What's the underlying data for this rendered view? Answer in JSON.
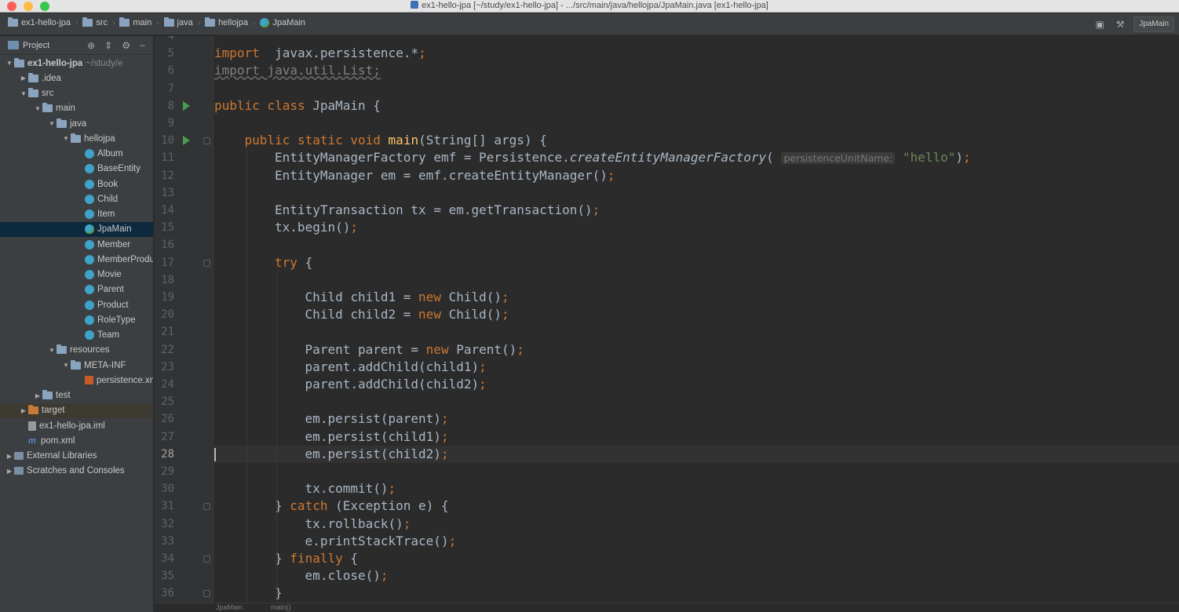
{
  "window": {
    "title": "ex1-hello-jpa [~/study/ex1-hello-jpa] - .../src/main/java/hellojpa/JpaMain.java [ex1-hello-jpa]"
  },
  "navbar": {
    "crumbs": [
      "ex1-hello-jpa",
      "src",
      "main",
      "java",
      "hellojpa",
      "JpaMain"
    ],
    "run_config": "JpaMain"
  },
  "project": {
    "title": "Project",
    "tree": [
      {
        "label": "ex1-hello-jpa",
        "suffix": "~/study/e",
        "icon": "module-folder-icon",
        "arrow": "▼",
        "indent": 0,
        "bold": true
      },
      {
        "label": ".idea",
        "icon": "folder-icon",
        "arrow": "▶",
        "indent": 1
      },
      {
        "label": "src",
        "icon": "folder-icon",
        "arrow": "▼",
        "indent": 1
      },
      {
        "label": "main",
        "icon": "folder-icon",
        "arrow": "▼",
        "indent": 2
      },
      {
        "label": "java",
        "icon": "source-folder-icon",
        "arrow": "▼",
        "indent": 3
      },
      {
        "label": "hellojpa",
        "icon": "package-icon",
        "arrow": "▼",
        "indent": 4
      },
      {
        "label": "Album",
        "icon": "class-icon",
        "arrow": "",
        "indent": 5
      },
      {
        "label": "BaseEntity",
        "icon": "class-icon",
        "arrow": "",
        "indent": 5
      },
      {
        "label": "Book",
        "icon": "class-icon",
        "arrow": "",
        "indent": 5
      },
      {
        "label": "Child",
        "icon": "class-icon",
        "arrow": "",
        "indent": 5
      },
      {
        "label": "Item",
        "icon": "class-icon",
        "arrow": "",
        "indent": 5
      },
      {
        "label": "JpaMain",
        "icon": "main-class-icon",
        "arrow": "",
        "indent": 5,
        "selected": true
      },
      {
        "label": "Member",
        "icon": "class-icon",
        "arrow": "",
        "indent": 5
      },
      {
        "label": "MemberProduct",
        "icon": "class-icon",
        "arrow": "",
        "indent": 5
      },
      {
        "label": "Movie",
        "icon": "class-icon",
        "arrow": "",
        "indent": 5
      },
      {
        "label": "Parent",
        "icon": "class-icon",
        "arrow": "",
        "indent": 5
      },
      {
        "label": "Product",
        "icon": "class-icon",
        "arrow": "",
        "indent": 5
      },
      {
        "label": "RoleType",
        "icon": "class-icon",
        "arrow": "",
        "indent": 5
      },
      {
        "label": "Team",
        "icon": "class-icon",
        "arrow": "",
        "indent": 5
      },
      {
        "label": "resources",
        "icon": "resources-folder-icon",
        "arrow": "▼",
        "indent": 3
      },
      {
        "label": "META-INF",
        "icon": "folder-icon",
        "arrow": "▼",
        "indent": 4
      },
      {
        "label": "persistence.xml",
        "icon": "xml-file-icon",
        "arrow": "",
        "indent": 5
      },
      {
        "label": "test",
        "icon": "folder-icon",
        "arrow": "▶",
        "indent": 2
      },
      {
        "label": "target",
        "icon": "excluded-folder-icon",
        "arrow": "▶",
        "indent": 1,
        "highlight": true
      },
      {
        "label": "ex1-hello-jpa.iml",
        "icon": "iml-file-icon",
        "arrow": "",
        "indent": 1
      },
      {
        "label": "pom.xml",
        "icon": "maven-icon",
        "arrow": "",
        "indent": 1
      },
      {
        "label": "External Libraries",
        "icon": "library-icon",
        "arrow": "▶",
        "indent": 0
      },
      {
        "label": "Scratches and Consoles",
        "icon": "scratch-icon",
        "arrow": "▶",
        "indent": 0
      }
    ]
  },
  "editor": {
    "current_line": 28,
    "lines": [
      {
        "n": 4,
        "indent": 0,
        "tokens": []
      },
      {
        "n": 5,
        "indent": 0,
        "tokens": [
          [
            "kw",
            "import"
          ],
          [
            "",
            "  javax.persistence.*"
          ],
          [
            "kw",
            ";"
          ]
        ]
      },
      {
        "n": 6,
        "indent": 0,
        "tokens": [
          [
            "unused",
            "import java.util.List;"
          ]
        ]
      },
      {
        "n": 7,
        "indent": 0,
        "tokens": []
      },
      {
        "n": 8,
        "indent": 0,
        "run": true,
        "tokens": [
          [
            "kw",
            "public class "
          ],
          [
            "",
            "JpaMain {"
          ]
        ]
      },
      {
        "n": 9,
        "indent": 0,
        "tokens": []
      },
      {
        "n": 10,
        "indent": 1,
        "run": true,
        "fold": true,
        "tokens": [
          [
            "kw",
            "public static void "
          ],
          [
            "fn",
            "main"
          ],
          [
            "",
            "(String[] args) {"
          ]
        ]
      },
      {
        "n": 11,
        "indent": 2,
        "tokens": [
          [
            "",
            "EntityManagerFactory emf = Persistence."
          ],
          [
            "it",
            "createEntityManagerFactory"
          ],
          [
            "",
            "( "
          ],
          [
            "hint",
            "persistenceUnitName:"
          ],
          [
            "",
            " "
          ],
          [
            "str",
            "\"hello\""
          ],
          [
            "",
            ")"
          ],
          [
            "kw",
            ";"
          ]
        ]
      },
      {
        "n": 12,
        "indent": 2,
        "tokens": [
          [
            "",
            "EntityManager em = emf.createEntityManager()"
          ],
          [
            "kw",
            ";"
          ]
        ]
      },
      {
        "n": 13,
        "indent": 0,
        "tokens": []
      },
      {
        "n": 14,
        "indent": 2,
        "tokens": [
          [
            "",
            "EntityTransaction tx = em.getTransaction()"
          ],
          [
            "kw",
            ";"
          ]
        ]
      },
      {
        "n": 15,
        "indent": 2,
        "tokens": [
          [
            "",
            "tx.begin()"
          ],
          [
            "kw",
            ";"
          ]
        ]
      },
      {
        "n": 16,
        "indent": 0,
        "tokens": []
      },
      {
        "n": 17,
        "indent": 2,
        "fold": true,
        "tokens": [
          [
            "kw",
            "try "
          ],
          [
            "",
            "{"
          ]
        ]
      },
      {
        "n": 18,
        "indent": 0,
        "tokens": []
      },
      {
        "n": 19,
        "indent": 3,
        "tokens": [
          [
            "",
            "Child child1 = "
          ],
          [
            "kw",
            "new "
          ],
          [
            "",
            "Child()"
          ],
          [
            "kw",
            ";"
          ]
        ]
      },
      {
        "n": 20,
        "indent": 3,
        "tokens": [
          [
            "",
            "Child child2 = "
          ],
          [
            "kw",
            "new "
          ],
          [
            "",
            "Child()"
          ],
          [
            "kw",
            ";"
          ]
        ]
      },
      {
        "n": 21,
        "indent": 0,
        "tokens": []
      },
      {
        "n": 22,
        "indent": 3,
        "tokens": [
          [
            "",
            "Parent parent = "
          ],
          [
            "kw",
            "new "
          ],
          [
            "",
            "Parent()"
          ],
          [
            "kw",
            ";"
          ]
        ]
      },
      {
        "n": 23,
        "indent": 3,
        "tokens": [
          [
            "",
            "parent.addChild(child1)"
          ],
          [
            "kw",
            ";"
          ]
        ]
      },
      {
        "n": 24,
        "indent": 3,
        "tokens": [
          [
            "",
            "parent.addChild(child2)"
          ],
          [
            "kw",
            ";"
          ]
        ]
      },
      {
        "n": 25,
        "indent": 0,
        "tokens": []
      },
      {
        "n": 26,
        "indent": 3,
        "tokens": [
          [
            "",
            "em.persist(parent)"
          ],
          [
            "kw",
            ";"
          ]
        ]
      },
      {
        "n": 27,
        "indent": 3,
        "tokens": [
          [
            "",
            "em.persist(child1)"
          ],
          [
            "kw",
            ";"
          ]
        ]
      },
      {
        "n": 28,
        "indent": 3,
        "tokens": [
          [
            "",
            "em.persist(child2)"
          ],
          [
            "kw",
            ";"
          ]
        ]
      },
      {
        "n": 29,
        "indent": 0,
        "tokens": []
      },
      {
        "n": 30,
        "indent": 3,
        "tokens": [
          [
            "",
            "tx.commit()"
          ],
          [
            "kw",
            ";"
          ]
        ]
      },
      {
        "n": 31,
        "indent": 2,
        "fold": true,
        "tokens": [
          [
            "",
            "} "
          ],
          [
            "kw",
            "catch "
          ],
          [
            "",
            "(Exception e) {"
          ]
        ]
      },
      {
        "n": 32,
        "indent": 3,
        "tokens": [
          [
            "",
            "tx.rollback()"
          ],
          [
            "kw",
            ";"
          ]
        ]
      },
      {
        "n": 33,
        "indent": 3,
        "tokens": [
          [
            "",
            "e.printStackTrace()"
          ],
          [
            "kw",
            ";"
          ]
        ]
      },
      {
        "n": 34,
        "indent": 2,
        "fold": true,
        "tokens": [
          [
            "",
            "} "
          ],
          [
            "kw",
            "finally "
          ],
          [
            "",
            "{"
          ]
        ]
      },
      {
        "n": 35,
        "indent": 3,
        "tokens": [
          [
            "",
            "em.close()"
          ],
          [
            "kw",
            ";"
          ]
        ]
      },
      {
        "n": 36,
        "indent": 2,
        "fold": true,
        "tokens": [
          [
            "",
            "}"
          ]
        ]
      }
    ]
  },
  "bottom": {
    "crumbs": [
      "JpaMain",
      "main()"
    ]
  },
  "colors": {
    "keyword": "#cc7832",
    "function": "#ffc66d",
    "string": "#6a8759",
    "text": "#a9b7c6",
    "background": "#2b2b2b"
  }
}
